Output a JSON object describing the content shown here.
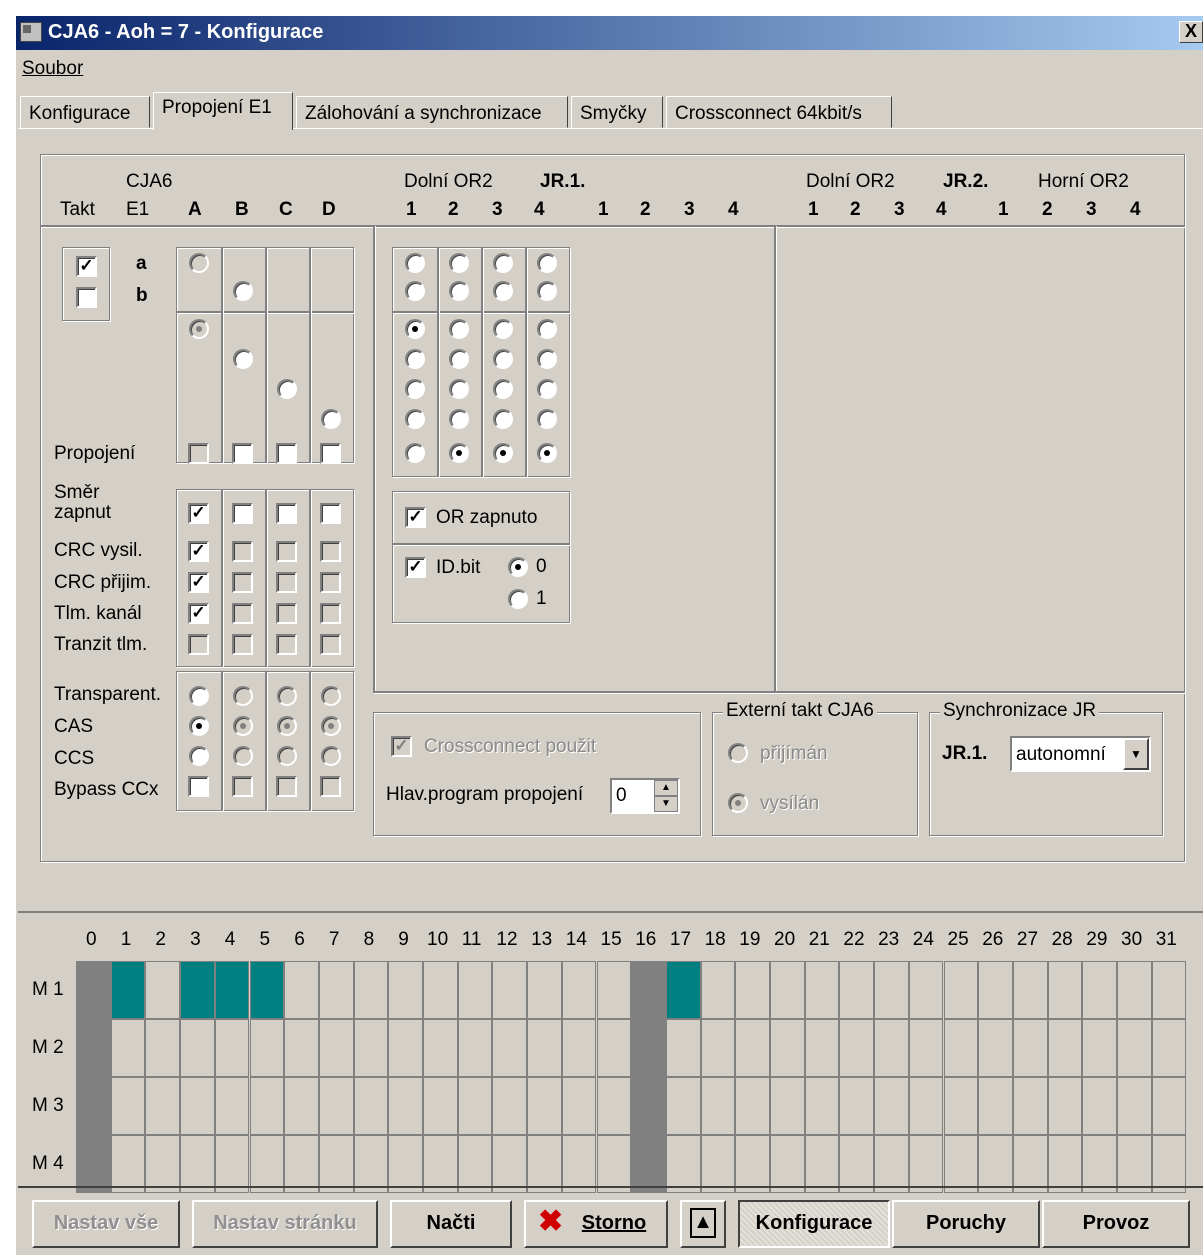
{
  "window": {
    "title": "CJA6 - Aoh = 7 - Konfigurace",
    "close": "X"
  },
  "menu": {
    "file": "Soubor"
  },
  "tabs": [
    "Konfigurace",
    "Propojení E1",
    "Zálohování a synchronizace",
    "Smyčky",
    "Crossconnect 64kbit/s"
  ],
  "header": {
    "cja6": "CJA6",
    "takt": "Takt",
    "e1": "E1",
    "cols": [
      "A",
      "B",
      "C",
      "D"
    ],
    "dolni1": "Dolní OR2",
    "jr1": "JR.1.",
    "nums": [
      "1",
      "2",
      "3",
      "4"
    ],
    "dolni2": "Dolní OR2",
    "jr2": "JR.2.",
    "horni": "Horní OR2"
  },
  "takt": {
    "a": "a",
    "b": "b",
    "a_checked": true,
    "b_checked": false
  },
  "labels": {
    "propojeni": "Propojení",
    "smer": "Směr zapnut",
    "crc_vysil": "CRC vysil.",
    "crc_prijim": "CRC přijim.",
    "tlm_kanal": "Tlm. kanál",
    "tranzit": "Tranzit tlm.",
    "transparent": "Transparent.",
    "cas": "CAS",
    "ccs": "CCS",
    "bypass": "Bypass CCx"
  },
  "or": {
    "zapnuto": "OR zapnuto",
    "idbit": "ID.bit",
    "opt0": "0",
    "opt1": "1"
  },
  "cross": {
    "label": "Crossconnect použit",
    "hlav": "Hlav.program propojení",
    "value": "0"
  },
  "ext": {
    "title": "Externí takt CJA6",
    "prijiman": "přijímán",
    "vysilan": "vysílán"
  },
  "sync": {
    "title": "Synchronizace JR",
    "jr": "JR.1.",
    "value": "autonomní"
  },
  "grid": {
    "rows": [
      "M 1",
      "M 2",
      "M 3",
      "M 4"
    ],
    "cols": [
      "0",
      "1",
      "2",
      "3",
      "4",
      "5",
      "6",
      "7",
      "8",
      "9",
      "10",
      "11",
      "12",
      "13",
      "14",
      "15",
      "16",
      "17",
      "18",
      "19",
      "20",
      "21",
      "22",
      "23",
      "24",
      "25",
      "26",
      "27",
      "28",
      "29",
      "30",
      "31"
    ],
    "teal_m1": [
      1,
      3,
      4,
      5,
      17
    ],
    "gray_cols": [
      0,
      16
    ],
    "colors": {
      "gray": "#808080",
      "teal": "#008080"
    }
  },
  "buttons": {
    "nastav_vse": "Nastav vše",
    "nastav_stranku": "Nastav stránku",
    "nacti": "Načti",
    "storno": "Storno",
    "konfigurace": "Konfigurace",
    "poruchy": "Poruchy",
    "provoz": "Provoz"
  }
}
